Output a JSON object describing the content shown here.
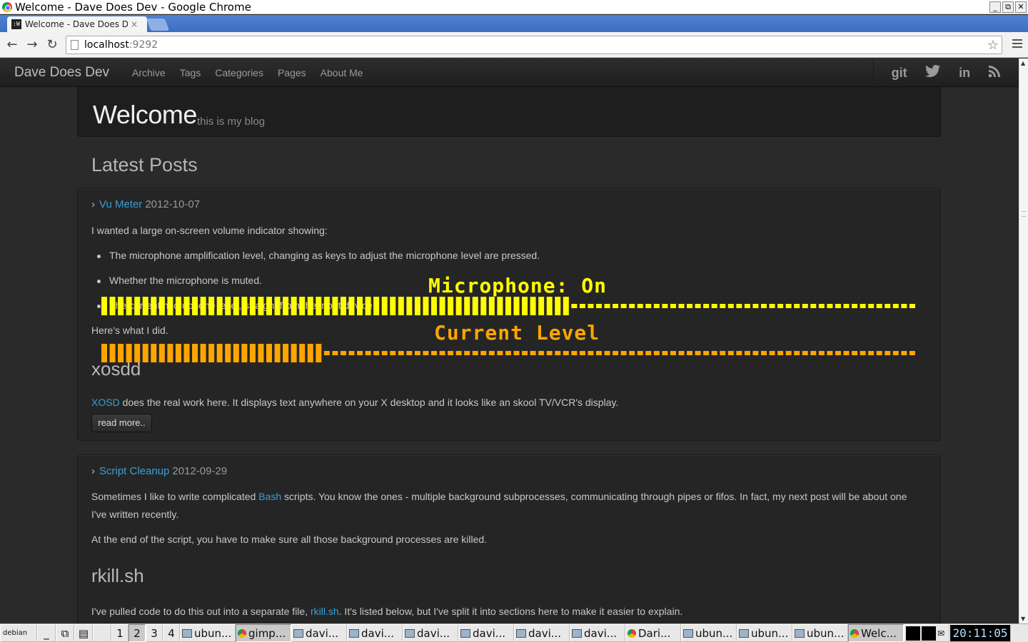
{
  "window": {
    "title": "Welcome - Dave Does Dev - Google Chrome",
    "controls": [
      "_",
      "⧉",
      "✕"
    ]
  },
  "tab": {
    "title": "Welcome - Dave Does Dev",
    "favicon": ":W",
    "close": "×"
  },
  "omnibox": {
    "host": "localhost",
    "port": ":9292"
  },
  "site": {
    "brand": "Dave Does Dev",
    "nav": [
      "Archive",
      "Tags",
      "Categories",
      "Pages",
      "About Me"
    ],
    "social": [
      "git",
      "twitter-icon",
      "linkedin-icon",
      "rss-icon"
    ],
    "social_labels": {
      "git": "git",
      "linkedin": "in"
    }
  },
  "hero": {
    "title": "Welcome",
    "subtitle": "this is my blog"
  },
  "latest_posts_title": "Latest Posts",
  "posts": [
    {
      "title": "Vu Meter",
      "date": "2012-10-07",
      "intro": "I wanted a large on-screen volume indicator showing:",
      "bullets": [
        "The microphone amplification level, changing as keys to adjust the microphone level are pressed.",
        "Whether the microphone is muted.",
        "The current microphone level, straight from the input device."
      ],
      "after": "Here's what I did.",
      "heading": "xosdd",
      "para_link": "XOSD",
      "para_rest": " does the real work here. It displays text anywhere on your X desktop and it looks like an skool TV/VCR's display.",
      "read_more": "read more.."
    },
    {
      "title": "Script Cleanup",
      "date": "2012-09-29",
      "p1_pre": "Sometimes I like to write complicated ",
      "p1_link": "Bash",
      "p1_post": " scripts. You know the ones - multiple background subprocesses, communicating through pipes or fifos. In fact, my next post will be about one",
      "p1_line2": "I've written recently.",
      "p2": "At the end of the script, you have to make sure all those background processes are killed.",
      "heading": "rkill.sh",
      "p3_pre": "I've pulled code to do this out into a separate file, ",
      "p3_link": "rkill.sh",
      "p3_post": ". It's listed below, but I've split it into sections here to make it easier to explain."
    }
  ],
  "osd": {
    "mic_label": "Microphone: On",
    "mic_level": 0.58,
    "current_label": "Current Level",
    "current_level": 0.27,
    "mic_color": "#ffff00",
    "current_color": "#ffa500"
  },
  "taskbar": {
    "logo": "debian",
    "desktops": [
      "1",
      "2",
      "3",
      "4"
    ],
    "active_desktop": "2",
    "tasks": [
      {
        "label": "ubun...",
        "icon": "terminal-icon"
      },
      {
        "label": "gimp...",
        "icon": "chrome-icon",
        "active": true
      },
      {
        "label": "davi...",
        "icon": "terminal-icon"
      },
      {
        "label": "davi...",
        "icon": "terminal-icon"
      },
      {
        "label": "davi...",
        "icon": "terminal-icon"
      },
      {
        "label": "davi...",
        "icon": "terminal-icon"
      },
      {
        "label": "davi...",
        "icon": "terminal-icon"
      },
      {
        "label": "davi...",
        "icon": "terminal-icon"
      },
      {
        "label": "Dari...",
        "icon": "chrome-icon"
      },
      {
        "label": "ubun...",
        "icon": "terminal-icon"
      },
      {
        "label": "ubun...",
        "icon": "terminal-icon"
      },
      {
        "label": "ubun...",
        "icon": "terminal-icon"
      },
      {
        "label": "Welc...",
        "icon": "chrome-icon",
        "active": true
      }
    ],
    "clock": "20:11:05"
  }
}
